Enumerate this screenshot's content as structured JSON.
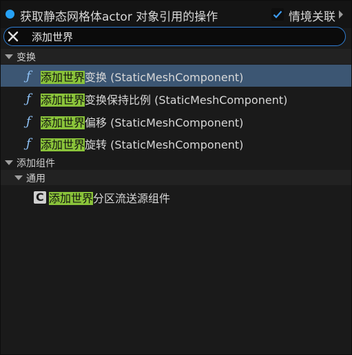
{
  "header": {
    "title": "获取静态网格体actor 对象引用的操作",
    "context_sensitive_label": "情境关联",
    "context_sensitive_checked": true
  },
  "search": {
    "value": "添加世界"
  },
  "categories": [
    {
      "label": "变换",
      "items": [
        {
          "highlight": "添加世界",
          "rest": "变换 (StaticMeshComponent)",
          "selected": true
        },
        {
          "highlight": "添加世界",
          "rest": "变换保持比例 (StaticMeshComponent)",
          "selected": false
        },
        {
          "highlight": "添加世界",
          "rest": "偏移 (StaticMeshComponent)",
          "selected": false
        },
        {
          "highlight": "添加世界",
          "rest": "旋转 (StaticMeshComponent)",
          "selected": false
        }
      ]
    },
    {
      "label": "添加组件",
      "subcategories": [
        {
          "label": "通用",
          "items": [
            {
              "highlight": "添加世界",
              "rest": "分区流送源组件",
              "icon": "class-icon"
            }
          ]
        }
      ]
    }
  ],
  "colors": {
    "accent_blue": "#26a1f5",
    "selection": "#3c5673",
    "match_highlight": "#8ac33a",
    "function_icon": "#8ec1f5"
  }
}
